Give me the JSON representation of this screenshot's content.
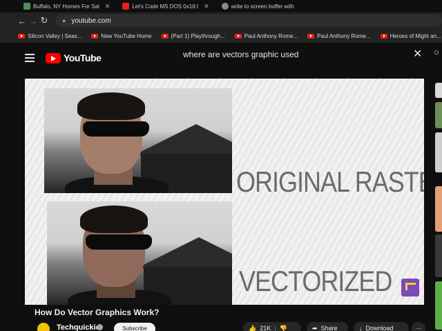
{
  "browser": {
    "tabs": [
      {
        "title": "Buffalo, NY Homes For Sal",
        "favicon_color": "#4a8f5a"
      },
      {
        "title": "Let's Code MS DOS 0x16:I",
        "favicon_color": "#e62117"
      },
      {
        "title": "write to screen buffer with",
        "favicon_color": "#8a8a8a"
      }
    ],
    "url": "youtube.com",
    "bookmarks": [
      "Silicon Valley | Seas...",
      "New YouTube Home",
      "(Part 1) Playthrough...",
      "Paul Anthony Rome...",
      "Paul Anthony Rome...",
      "Heroes of Might an..."
    ]
  },
  "youtube": {
    "logo_text": "YouTube",
    "search_query": "where are vectors graphic used",
    "video": {
      "caption_top": "ORIGINAL RASTER",
      "caption_bottom": "VECTORIZED",
      "title": "How Do Vector Graphics Work?",
      "channel": "Techquickie",
      "subscribe_label": "Subscribe",
      "likes": "21K",
      "share_label": "Share",
      "download_label": "Download",
      "more_label": "···"
    }
  },
  "colors": {
    "accent": "#ff0000",
    "bg": "#0f0f0f",
    "caption": "#6b6b6b",
    "channel_avatar": "#f2c300"
  }
}
